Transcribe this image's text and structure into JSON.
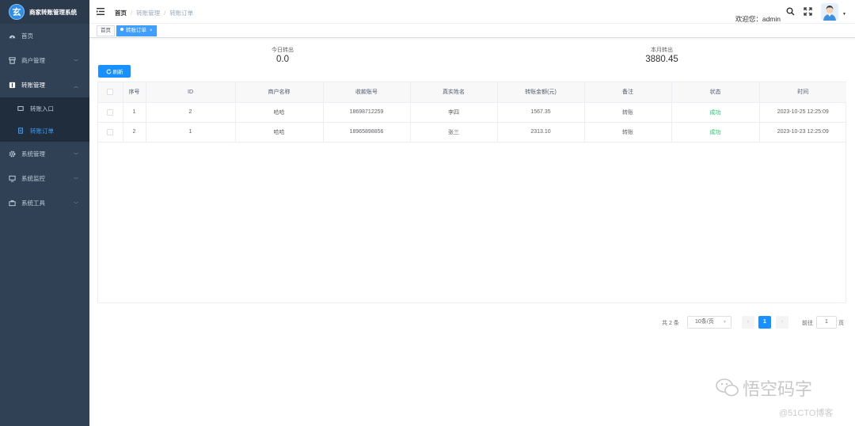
{
  "app": {
    "title": "商家转账管理系统",
    "logo_char": "玄"
  },
  "sidebar": {
    "items": [
      {
        "label": "首页",
        "icon": "dashboard-icon"
      },
      {
        "label": "商户管理",
        "icon": "shop-icon"
      },
      {
        "label": "转账管理",
        "icon": "transfer-icon",
        "open": true,
        "children": [
          {
            "label": "转账入口",
            "icon": "entry-icon"
          },
          {
            "label": "转账订单",
            "icon": "order-icon",
            "active": true
          }
        ]
      },
      {
        "label": "系统管理",
        "icon": "gear-icon"
      },
      {
        "label": "系统监控",
        "icon": "monitor-icon"
      },
      {
        "label": "系统工具",
        "icon": "toolbox-icon"
      }
    ]
  },
  "navbar": {
    "breadcrumb": [
      "首页",
      "转账管理",
      "转账订单"
    ],
    "welcome": "欢迎您：admin"
  },
  "tags": [
    {
      "label": "首页"
    },
    {
      "label": "转账订单",
      "active": true,
      "close": "×"
    }
  ],
  "stats": {
    "today": {
      "label": "今日转出",
      "value": "0.0"
    },
    "month": {
      "label": "本月转出",
      "value": "3880.45"
    }
  },
  "toolbar": {
    "refresh_label": "刷新"
  },
  "table": {
    "columns": [
      "",
      "序号",
      "ID",
      "商户名称",
      "收款账号",
      "真实姓名",
      "转账金额(元)",
      "备注",
      "状态",
      "时间"
    ],
    "rows": [
      [
        "",
        "1",
        "2",
        "哈哈",
        "18698712259",
        "李四",
        "1567.35",
        "转账",
        "成功",
        "2023-10-25 12:25:09"
      ],
      [
        "",
        "2",
        "1",
        "哈哈",
        "18965898856",
        "张三",
        "2313.10",
        "转账",
        "成功",
        "2023-10-23 12:25:09"
      ]
    ],
    "status_color": "#13ce66"
  },
  "pagination": {
    "total": "共 2 条",
    "page_size": "10条/页",
    "prev": "‹",
    "next": "›",
    "current": "1",
    "goto_label": "前往",
    "goto_value": "1",
    "goto_suffix": "页"
  },
  "watermark": {
    "main": "悟空码字",
    "sub": "@51CTO博客"
  },
  "colors": {
    "sidebar": "#304156",
    "accent": "#1890ff",
    "active_menu": "#409eff"
  }
}
